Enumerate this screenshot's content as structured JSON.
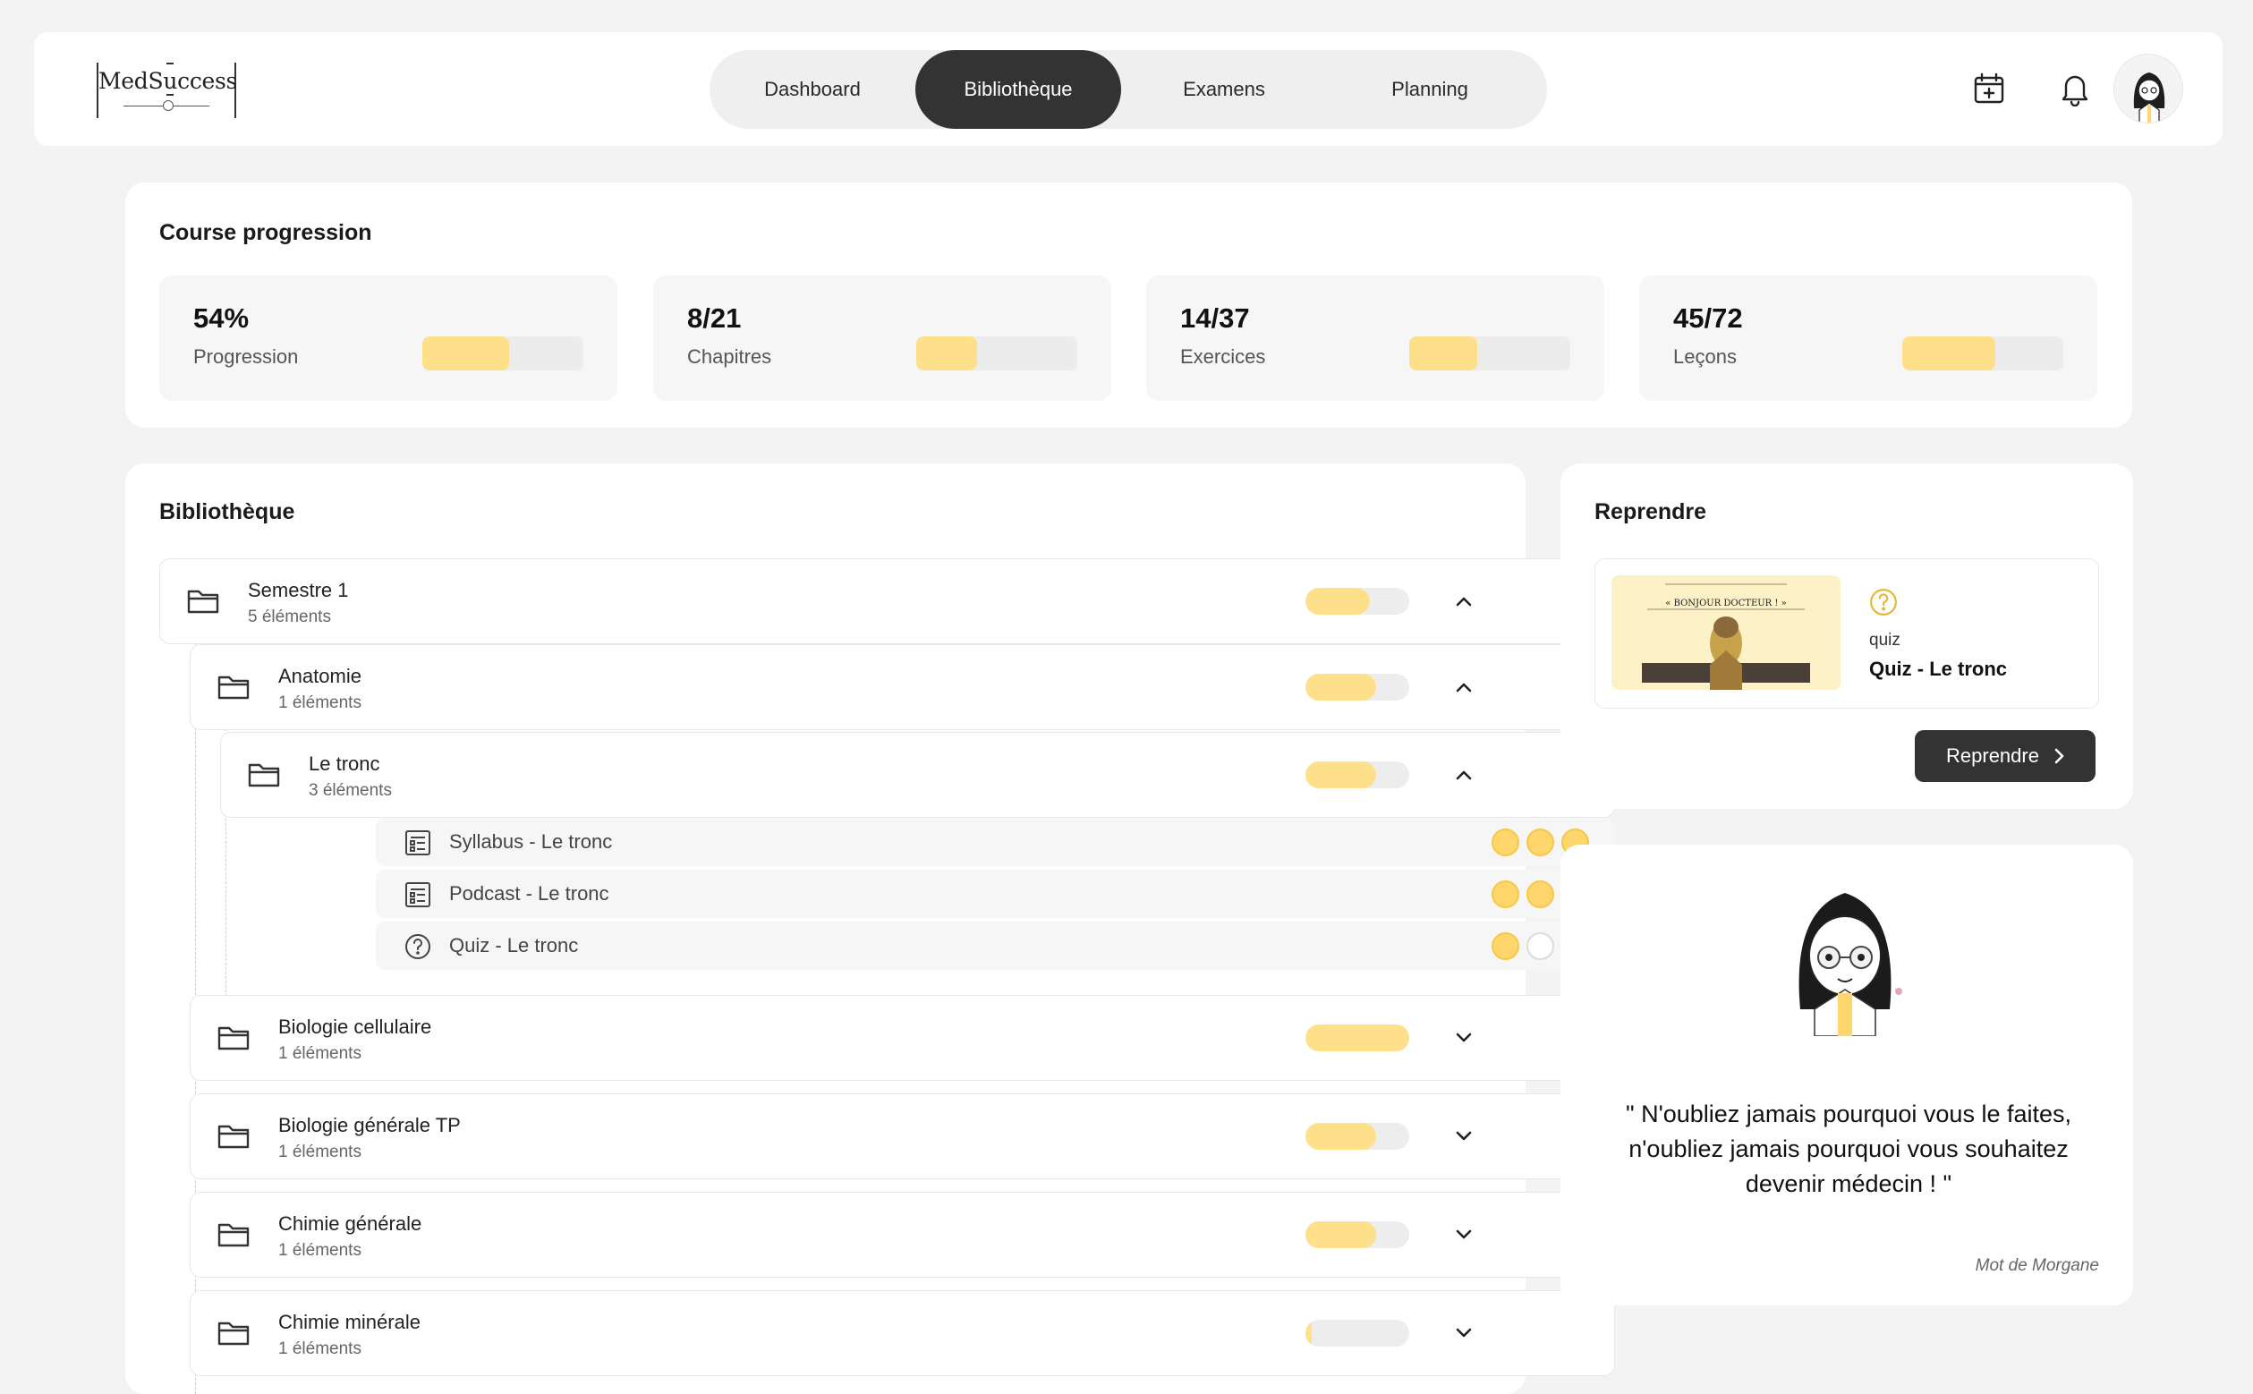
{
  "header": {
    "logo_text": "MedSuccess",
    "nav": [
      {
        "label": "Dashboard",
        "active": false
      },
      {
        "label": "Bibliothèque",
        "active": true
      },
      {
        "label": "Examens",
        "active": false
      },
      {
        "label": "Planning",
        "active": false
      }
    ],
    "icons": [
      "calendar-add-icon",
      "bell-icon",
      "avatar"
    ]
  },
  "progression": {
    "title": "Course progression",
    "stats": [
      {
        "value": "54%",
        "label": "Progression",
        "fill": 0.54
      },
      {
        "value": "8/21",
        "label": "Chapitres",
        "fill": 0.38
      },
      {
        "value": "14/37",
        "label": "Exercices",
        "fill": 0.42
      },
      {
        "value": "45/72",
        "label": "Leçons",
        "fill": 0.58
      }
    ]
  },
  "library": {
    "title": "Bibliothèque",
    "folders": [
      {
        "name": "Semestre 1",
        "count": "5 éléments",
        "fill": 0.62,
        "expanded": true
      },
      {
        "name": "Anatomie",
        "count": "1 éléments",
        "fill": 0.68,
        "expanded": true
      },
      {
        "name": "Le tronc",
        "count": "3 éléments",
        "fill": 0.68,
        "expanded": true
      },
      {
        "name": "Biologie cellulaire",
        "count": "1 éléments",
        "fill": 1.0,
        "expanded": false
      },
      {
        "name": "Biologie générale TP",
        "count": "1 éléments",
        "fill": 0.68,
        "expanded": false
      },
      {
        "name": "Chimie générale",
        "count": "1 éléments",
        "fill": 0.68,
        "expanded": false
      },
      {
        "name": "Chimie minérale",
        "count": "1 éléments",
        "fill": 0.06,
        "expanded": false
      }
    ],
    "items": [
      {
        "name": "Syllabus - Le tronc",
        "icon": "document-icon",
        "level": 3
      },
      {
        "name": "Podcast - Le tronc",
        "icon": "document-icon",
        "level": 2
      },
      {
        "name": "Quiz - Le tronc",
        "icon": "question-icon",
        "level": 1
      }
    ]
  },
  "resume": {
    "title": "Reprendre",
    "type": "quiz",
    "name": "Quiz - Le tronc",
    "thumb_caption": "« BONJOUR DOCTEUR ! »",
    "button": "Reprendre"
  },
  "motivation": {
    "quote": "\" N'oubliez jamais pourquoi vous le faites, n'oubliez jamais pourquoi vous souhaitez devenir médecin ! \"",
    "author": "Mot de Morgane"
  },
  "colors": {
    "accent": "#ffe08a",
    "dark": "#333333",
    "bg": "#f3f3f3"
  }
}
